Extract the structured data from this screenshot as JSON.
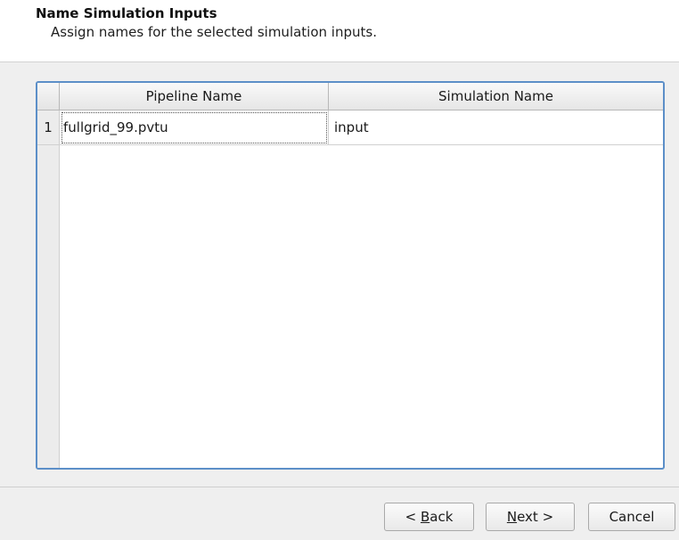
{
  "header": {
    "title": "Name Simulation Inputs",
    "subtitle": "Assign names for the selected simulation inputs."
  },
  "table": {
    "columns": [
      "Pipeline Name",
      "Simulation Name"
    ],
    "rows": [
      {
        "index": "1",
        "pipeline_name": "fullgrid_99.pvtu",
        "simulation_name": "input"
      }
    ]
  },
  "buttons": {
    "back": {
      "prefix": "< ",
      "mnemonic": "B",
      "rest": "ack"
    },
    "next": {
      "mnemonic": "N",
      "rest": "ext >"
    },
    "cancel": "Cancel"
  },
  "colors": {
    "table_focus_border": "#5c8fc8",
    "header_background": "#ffffff",
    "dialog_background": "#efefef"
  }
}
